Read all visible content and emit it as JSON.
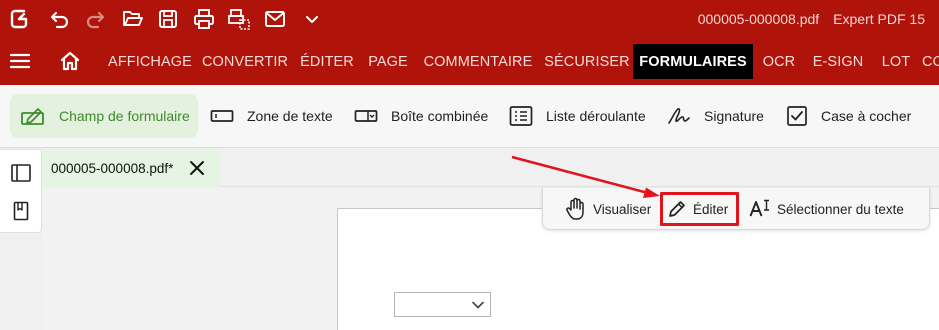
{
  "titlebar": {
    "file_name": "000005-000008.pdf",
    "app_name": "Expert PDF 15",
    "quick_access": [
      "app-logo-icon",
      "undo-icon",
      "redo-icon",
      "open-folder-icon",
      "save-icon",
      "print-icon",
      "scan-icon",
      "mail-icon",
      "chevron-down-icon"
    ]
  },
  "menubar": {
    "tabs": [
      {
        "label": "AFFICHAGE"
      },
      {
        "label": "CONVERTIR"
      },
      {
        "label": "ÉDITER"
      },
      {
        "label": "PAGE"
      },
      {
        "label": "COMMENTAIRE"
      },
      {
        "label": "SÉCURISER"
      },
      {
        "label": "FORMULAIRES",
        "active": true
      },
      {
        "label": "OCR"
      },
      {
        "label": "E-SIGN"
      },
      {
        "label": "LOT"
      },
      {
        "label": "CO"
      }
    ]
  },
  "ribbon": {
    "items": [
      {
        "label": "Champ de formulaire",
        "icon": "form-field-icon",
        "selected": true
      },
      {
        "label": "Zone de texte",
        "icon": "text-box-icon"
      },
      {
        "label": "Boîte combinée",
        "icon": "combo-box-icon"
      },
      {
        "label": "Liste déroulante",
        "icon": "list-box-icon"
      },
      {
        "label": "Signature",
        "icon": "signature-icon"
      },
      {
        "label": "Case à cocher",
        "icon": "checkbox-icon"
      }
    ]
  },
  "document": {
    "tab_label": "000005-000008.pdf*"
  },
  "modebar": {
    "view_label": "Visualiser",
    "edit_label": "Éditer",
    "select_text_label": "Sélectionner du texte"
  },
  "colors": {
    "brand": "#b01309",
    "active_tab": "#000000",
    "selected_green": "#3d8a2c",
    "annotation_red": "#e0141c"
  }
}
